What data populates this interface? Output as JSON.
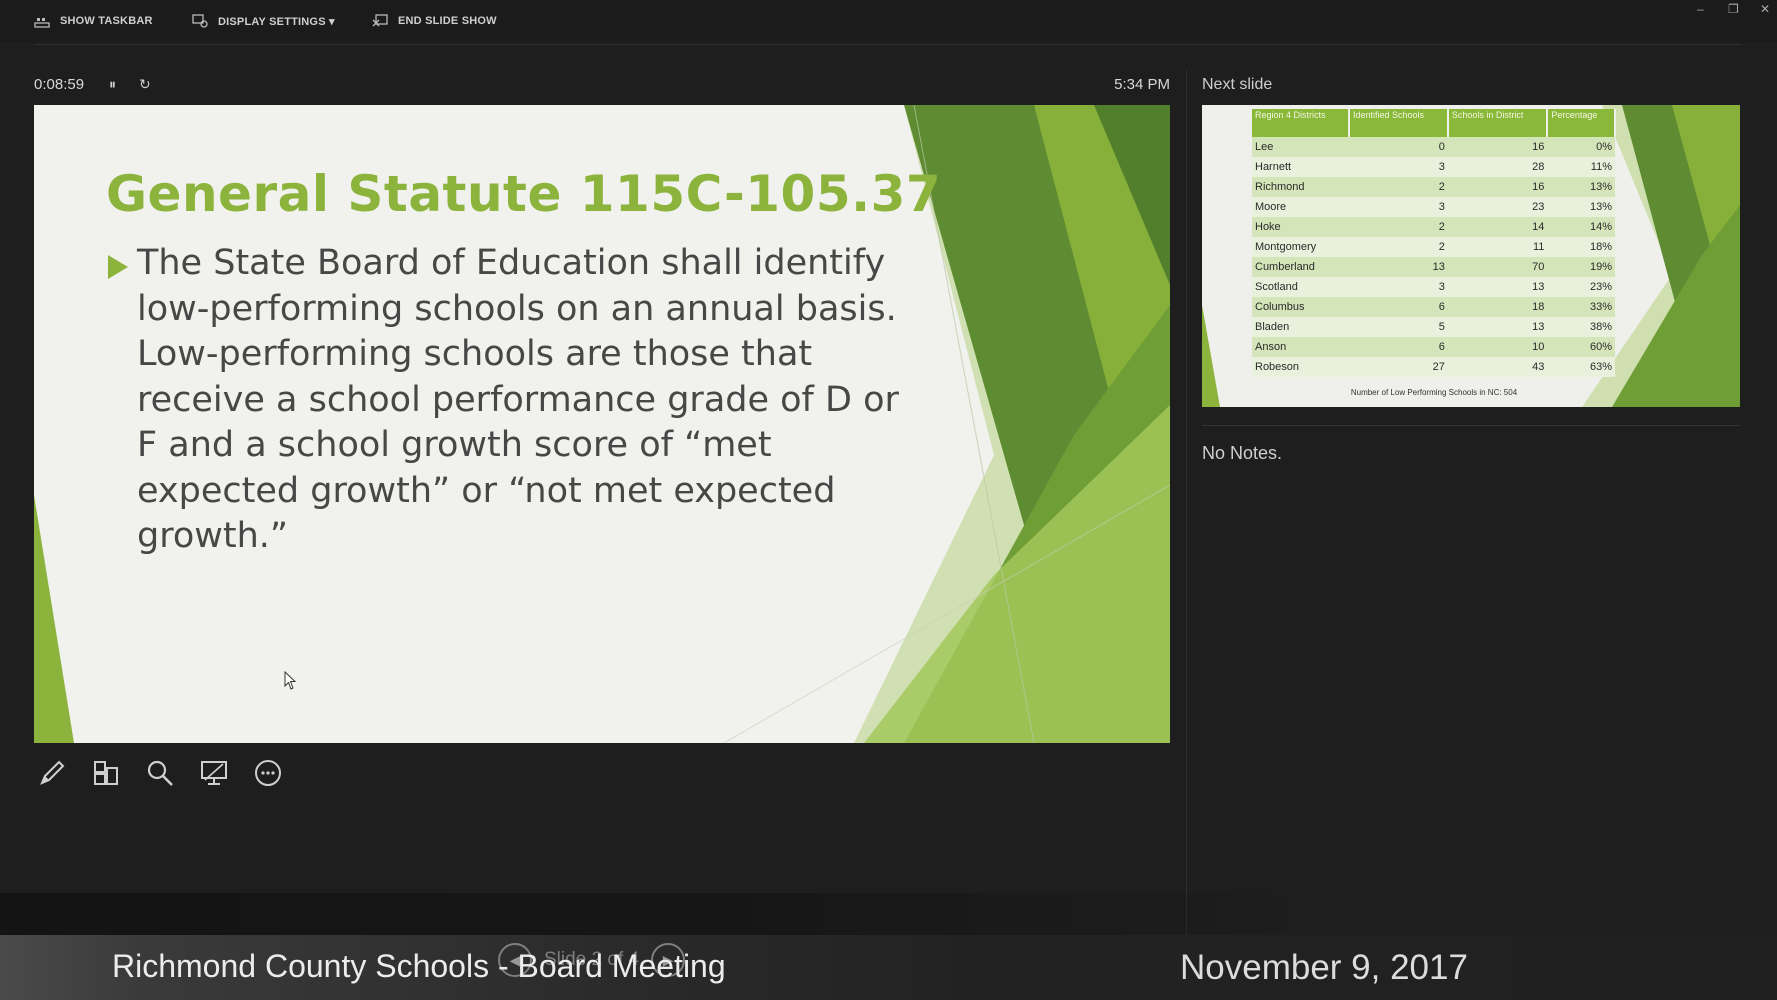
{
  "toolbar": {
    "show_taskbar": "SHOW TASKBAR",
    "display_settings": "DISPLAY SETTINGS ▾",
    "end_slide_show": "END SLIDE SHOW"
  },
  "window_controls": {
    "minimize": "–",
    "restore": "❐",
    "close": "✕"
  },
  "presenter": {
    "timer": "0:08:59",
    "pause_icon": "⏸",
    "restart_icon": "↻",
    "clock": "5:34 PM"
  },
  "current_slide": {
    "title": "General Statute 115C-105.37",
    "bullet": "The State Board of Education shall identify low-performing schools on an annual basis. Low-performing schools are those that receive a school performance grade of D or F and a school growth score of “met expected growth” or “not met expected growth.”",
    "accent_color": "#8cb43c"
  },
  "slide_tools": [
    "pen-icon",
    "grid-icon",
    "zoom-icon",
    "screen-icon",
    "more-icon"
  ],
  "next_slide": {
    "label": "Next slide",
    "headers": [
      "Region 4 Districts",
      "Identified Schools",
      "Schools in District",
      "Percentage"
    ],
    "rows": [
      [
        "Lee",
        "0",
        "16",
        "0%"
      ],
      [
        "Harnett",
        "3",
        "28",
        "11%"
      ],
      [
        "Richmond",
        "2",
        "16",
        "13%"
      ],
      [
        "Moore",
        "3",
        "23",
        "13%"
      ],
      [
        "Hoke",
        "2",
        "14",
        "14%"
      ],
      [
        "Montgomery",
        "2",
        "11",
        "18%"
      ],
      [
        "Cumberland",
        "13",
        "70",
        "19%"
      ],
      [
        "Scotland",
        "3",
        "13",
        "23%"
      ],
      [
        "Columbus",
        "6",
        "18",
        "33%"
      ],
      [
        "Bladen",
        "5",
        "13",
        "38%"
      ],
      [
        "Anson",
        "6",
        "10",
        "60%"
      ],
      [
        "Robeson",
        "27",
        "43",
        "63%"
      ]
    ],
    "footnote": "Number of Low Performing Schools in NC: 504"
  },
  "notes": "No Notes.",
  "navigation": {
    "prev": "◀",
    "slide_counter": "Slide 2 of 4",
    "next": "▶"
  },
  "caption": {
    "left": "Richmond County Schools - Board Meeting",
    "right": "November 9, 2017"
  }
}
